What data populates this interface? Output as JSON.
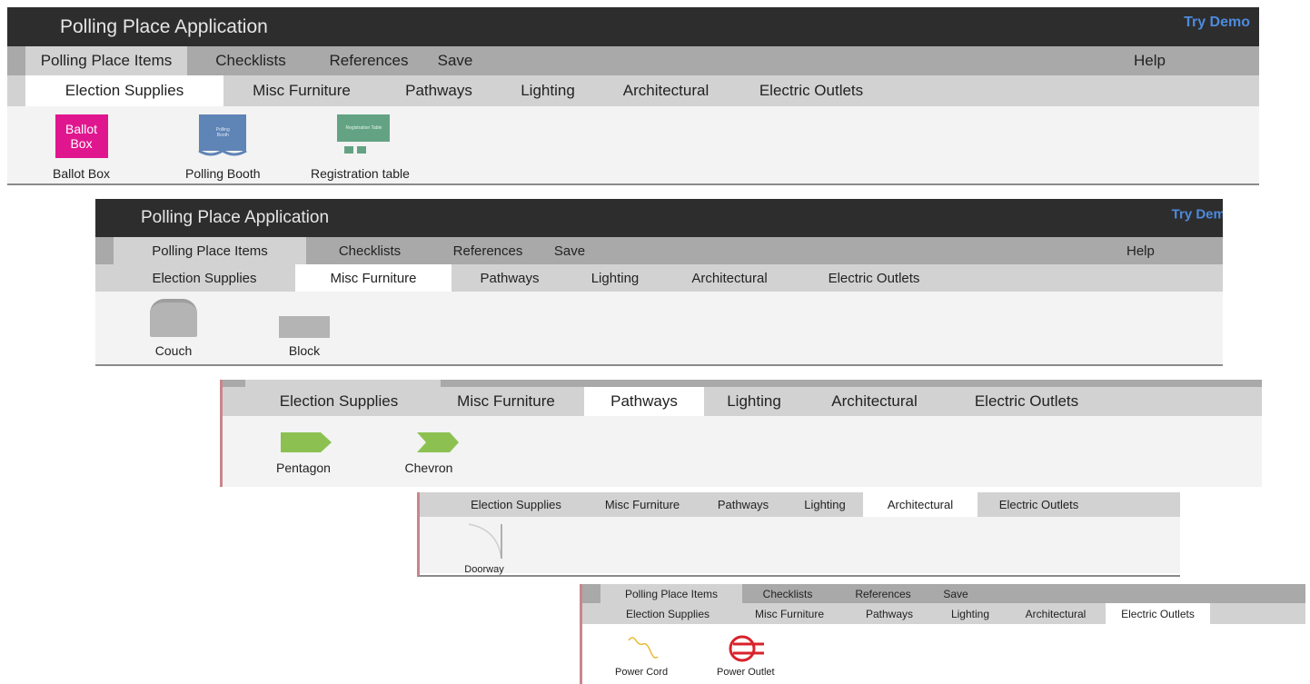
{
  "panel1": {
    "title": "Polling Place Application",
    "try_demo": "Try Demo",
    "menu": [
      "Polling Place Items",
      "Checklists",
      "References",
      "Save"
    ],
    "help": "Help",
    "subtabs": [
      "Election Supplies",
      "Misc Furniture",
      "Pathways",
      "Lighting",
      "Architectural",
      "Electric Outlets"
    ],
    "items": {
      "ballot_box_icon_text": "Ballot Box",
      "ballot_box": "Ballot Box",
      "booth_icon_text": "Polling Booth",
      "polling_booth": "Polling Booth",
      "table_icon_text": "Registration Table",
      "registration_table": "Registration table"
    }
  },
  "panel2": {
    "title": "Polling Place Application",
    "try_demo": "Try Demo",
    "menu": [
      "Polling Place Items",
      "Checklists",
      "References",
      "Save"
    ],
    "help": "Help",
    "subtabs": [
      "Election Supplies",
      "Misc Furniture",
      "Pathways",
      "Lighting",
      "Architectural",
      "Electric Outlets"
    ],
    "items": {
      "couch": "Couch",
      "block": "Block"
    }
  },
  "panel3": {
    "subtabs": [
      "Election Supplies",
      "Misc Furniture",
      "Pathways",
      "Lighting",
      "Architectural",
      "Electric Outlets"
    ],
    "items": {
      "pentagon": "Pentagon",
      "chevron": "Chevron"
    }
  },
  "panel4": {
    "subtabs": [
      "Election Supplies",
      "Misc Furniture",
      "Pathways",
      "Lighting",
      "Architectural",
      "Electric Outlets"
    ],
    "items": {
      "doorway": "Doorway"
    }
  },
  "panel5": {
    "menu": [
      "Polling Place Items",
      "Checklists",
      "References",
      "Save"
    ],
    "subtabs": [
      "Election Supplies",
      "Misc Furniture",
      "Pathways",
      "Lighting",
      "Architectural",
      "Electric Outlets"
    ],
    "items": {
      "power_cord": "Power Cord",
      "power_outlet": "Power Outlet"
    }
  },
  "colors": {
    "titlebar": "#2d2d2d",
    "menubar": "#a9a9a9",
    "subbar": "#d2d2d2",
    "ballot_box": "#e0168f",
    "polling_booth": "#5f84b6",
    "registration_table": "#63a383",
    "pathway_green": "#8cc152",
    "power_cord": "#e8b830",
    "power_outlet": "#d8232a",
    "try_demo": "#4d8bdc"
  }
}
